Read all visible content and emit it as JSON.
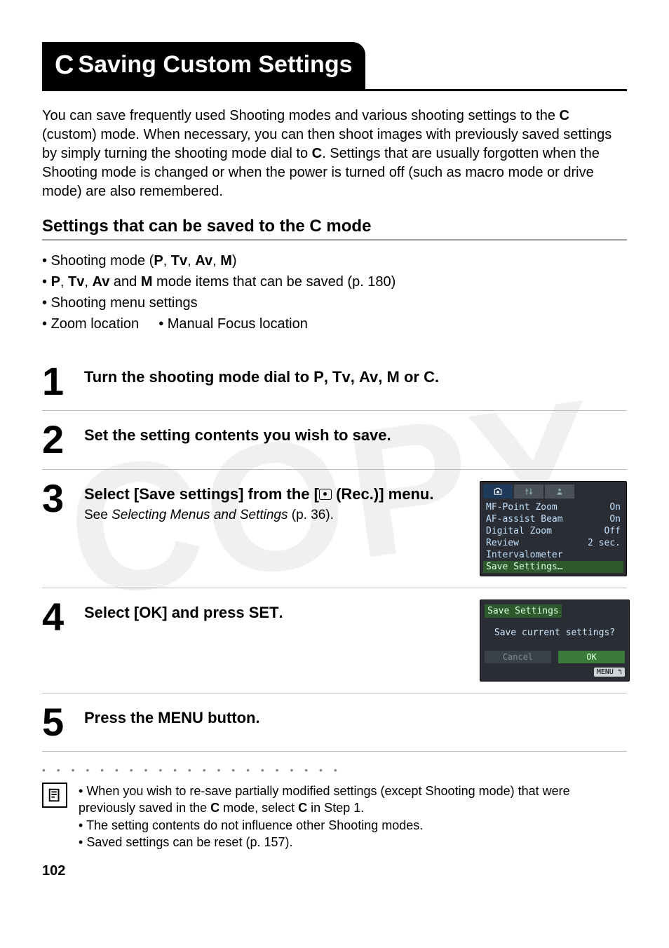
{
  "watermark": "COPY",
  "title": {
    "icon": "C",
    "text": "Saving Custom Settings"
  },
  "intro": {
    "part1": "You can save frequently used Shooting modes and various shooting settings to the ",
    "c1": "C",
    "part2": " (custom) mode. When necessary, you can then shoot images with previously saved settings by simply turning the shooting mode dial to ",
    "c2": "C",
    "part3": ". Settings that are usually forgotten when the Shooting mode is changed or when the power is turned off (such as macro mode or drive mode) are also remembered."
  },
  "subheader": {
    "part1": "Settings that can be saved to the ",
    "c": "C",
    "part2": " mode"
  },
  "bullets": {
    "b1_pre": "Shooting mode (",
    "b1_p": "P",
    "b1_tv": "Tv",
    "b1_av": "Av",
    "b1_m": "M",
    "b1_post": ")",
    "b2_p": "P",
    "b2_tv": "Tv",
    "b2_av": "Av",
    "b2_and": " and ",
    "b2_m": "M",
    "b2_rest": " mode items that can be saved (p. 180)",
    "b3": "Shooting menu settings",
    "b4a": "Zoom location",
    "b4b": "Manual Focus location"
  },
  "steps": {
    "s1": {
      "num": "1",
      "pre": "Turn the shooting mode dial to ",
      "p": "P",
      "tv": "Tv",
      "av": "Av",
      "m": "M",
      "or": " or ",
      "c": "C",
      "post": "."
    },
    "s2": {
      "num": "2",
      "text": "Set the setting contents you wish to save."
    },
    "s3": {
      "num": "3",
      "text_a": "Select [Save settings] from the [",
      "text_b": " (Rec.)] menu.",
      "sub_a": "See ",
      "sub_em": "Selecting Menus and Settings",
      "sub_b": " (p. 36)."
    },
    "s4": {
      "num": "4",
      "text_a": "Select [OK] and press ",
      "set": "SET",
      "text_b": "."
    },
    "s5": {
      "num": "5",
      "text_a": "Press the ",
      "menu": "MENU",
      "text_b": " button."
    }
  },
  "menu_screen": {
    "rows": [
      {
        "label": "MF-Point Zoom",
        "value": "On"
      },
      {
        "label": "AF-assist Beam",
        "value": "On"
      },
      {
        "label": "Digital Zoom",
        "value": "Off"
      },
      {
        "label": "Review",
        "value": "2 sec."
      },
      {
        "label": "Intervalometer",
        "value": ""
      },
      {
        "label": "Save Settings…",
        "value": ""
      }
    ]
  },
  "save_screen": {
    "title": "Save Settings",
    "msg": "Save current settings?",
    "cancel": "Cancel",
    "ok": "OK",
    "menu_chip": "MENU ↰"
  },
  "dots": "• • • • • • • • • • • • • • • • • • • • •",
  "notes": {
    "n1_a": "When you wish to re-save partially modified settings (except Shooting mode) that were previously saved in the ",
    "n1_c1": "C",
    "n1_b": " mode, select ",
    "n1_c2": "C",
    "n1_c": " in Step 1.",
    "n2": "The setting contents do not influence other Shooting modes.",
    "n3": "Saved settings can be reset (p. 157)."
  },
  "page_num": "102"
}
